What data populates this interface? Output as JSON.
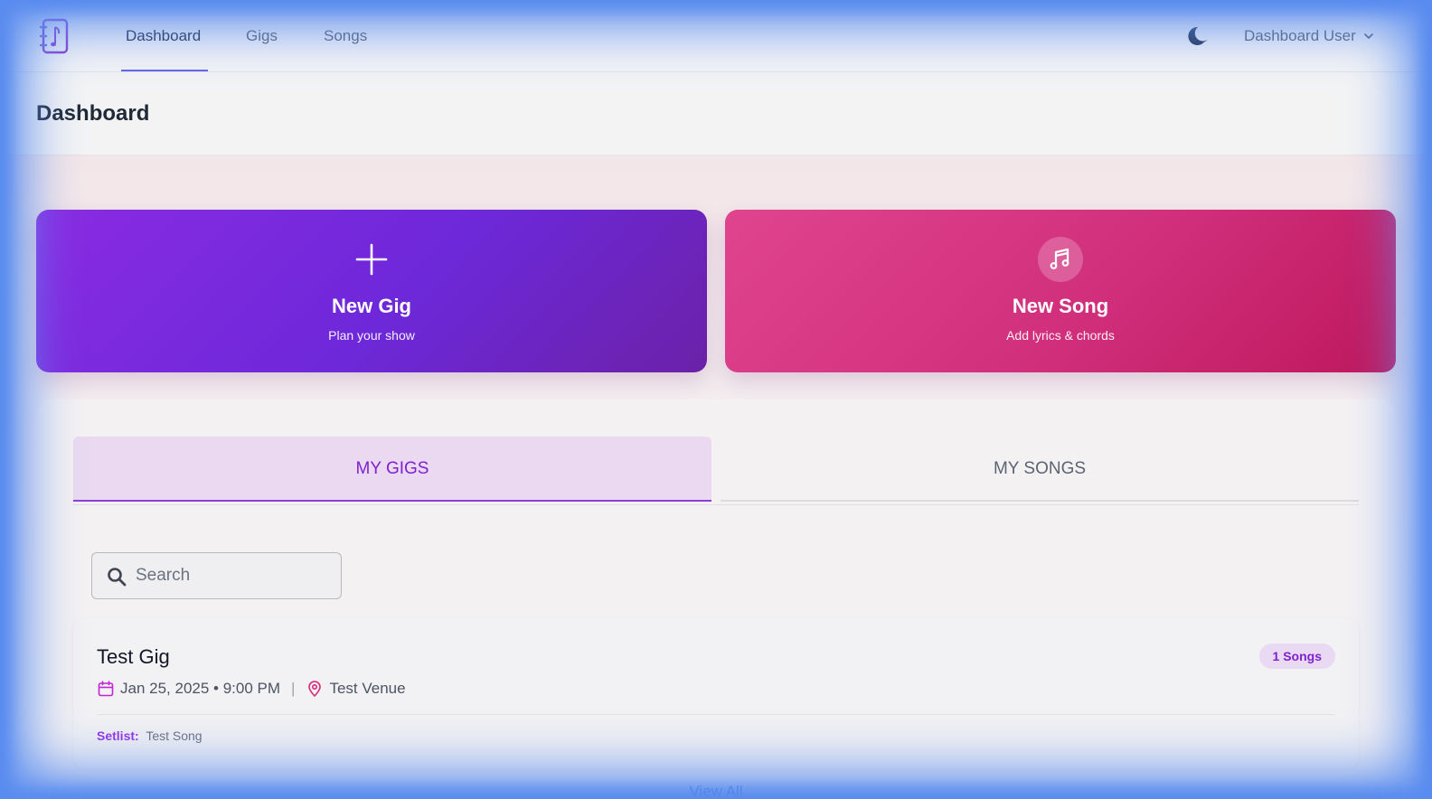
{
  "nav": {
    "links": [
      {
        "label": "Dashboard",
        "active": true
      },
      {
        "label": "Gigs",
        "active": false
      },
      {
        "label": "Songs",
        "active": false
      }
    ],
    "user_label": "Dashboard User",
    "theme_icon": "moon-icon",
    "logo_icon": "songbook-logo"
  },
  "header": {
    "title": "Dashboard"
  },
  "actions": {
    "new_gig": {
      "title": "New Gig",
      "subtitle": "Plan your show",
      "icon": "plus-icon"
    },
    "new_song": {
      "title": "New Song",
      "subtitle": "Add lyrics & chords",
      "icon": "music-note-icon"
    }
  },
  "tabs": [
    {
      "label": "MY GIGS",
      "active": true
    },
    {
      "label": "MY SONGS",
      "active": false
    }
  ],
  "search": {
    "placeholder": "Search",
    "value": ""
  },
  "gigs": [
    {
      "title": "Test Gig",
      "badge": "1 Songs",
      "date_time": "Jan 25, 2025 • 9:00 PM",
      "separator": "|",
      "venue": "Test Venue",
      "setlist_label": "Setlist:",
      "setlist": "Test Song"
    }
  ],
  "view_all_label": "View All",
  "colors": {
    "accent_purple": "#7e22ce",
    "gig_card": "#7c3aed",
    "song_card": "#db2777",
    "nav_underline": "#6366f1"
  }
}
